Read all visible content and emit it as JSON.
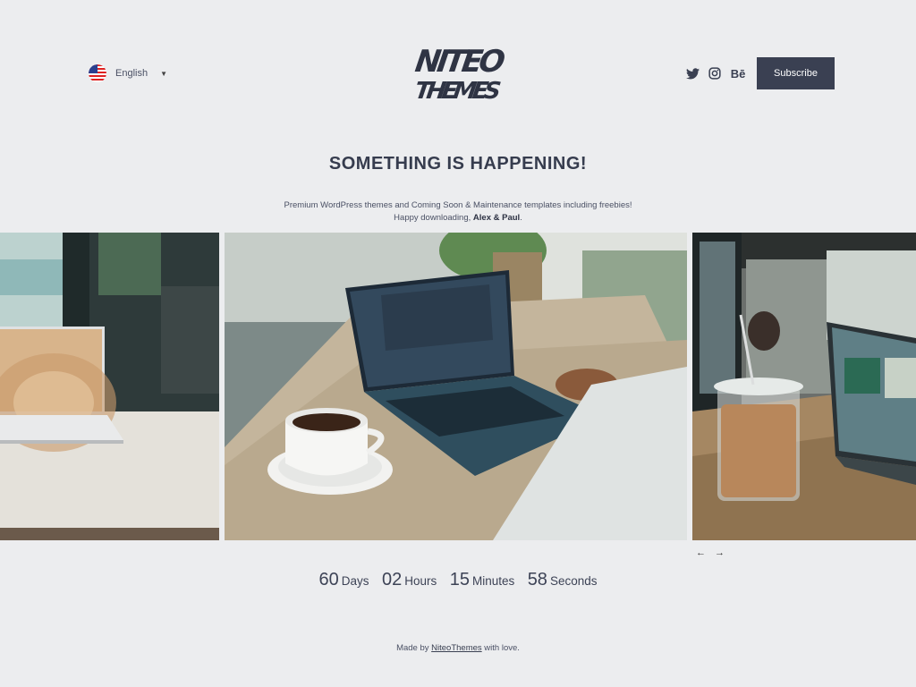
{
  "header": {
    "language": "English",
    "logo_line1": "NITEO",
    "logo_line2": "THEMES",
    "social": [
      {
        "name": "twitter-icon",
        "glyph": ""
      },
      {
        "name": "instagram-icon",
        "glyph": ""
      },
      {
        "name": "behance-icon",
        "glyph": "Bē"
      }
    ],
    "subscribe_label": "Subscribe"
  },
  "main": {
    "title": "SOMETHING IS HAPPENING!",
    "description_line1": "Premium WordPress themes and Coming Soon & Maintenance templates including freebies!",
    "description_line2_prefix": "Happy downloading, ",
    "description_line2_bold": "Alex & Paul",
    "description_line2_suffix": "."
  },
  "gallery": {
    "prev": "←",
    "next": "→"
  },
  "countdown": {
    "days": "60",
    "days_label": "Days",
    "hours": "02",
    "hours_label": "Hours",
    "minutes": "15",
    "minutes_label": "Minutes",
    "seconds": "58",
    "seconds_label": "Seconds"
  },
  "footer": {
    "prefix": "Made by ",
    "link": "NiteoThemes",
    "suffix": " with love."
  },
  "colors": {
    "background": "#ecedef",
    "accent": "#3a4052"
  }
}
